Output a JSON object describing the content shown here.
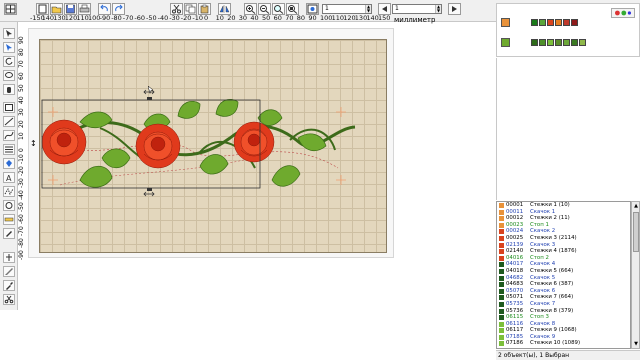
{
  "toolbar": {
    "spin1_value": "1",
    "spin2_value": "1",
    "spin3_value": "1"
  },
  "ruler": {
    "top_ticks": [
      "-150",
      "140",
      "130",
      "120",
      "110",
      "100",
      "-90",
      "-80",
      "-70",
      "-60",
      "-50",
      "-40",
      "-30",
      "-20",
      "-10",
      "0",
      "10",
      "20",
      "30",
      "40",
      "50",
      "60",
      "70",
      "80",
      "90",
      "100",
      "110",
      "120",
      "130",
      "140",
      "150"
    ],
    "left_ticks": [
      "90",
      "80",
      "70",
      "60",
      "50",
      "40",
      "30",
      "20",
      "10",
      "0",
      "-10",
      "-20",
      "-30",
      "-40",
      "-50",
      "-60",
      "-70",
      "-80",
      "-90"
    ],
    "unit_label": "миллиметр"
  },
  "threads": {
    "colors_row1": [
      "#1a7a1a",
      "#5aa53a",
      "#d9431e",
      "#e67e22",
      "#c0392b",
      "#8e1a1a"
    ],
    "colors_row2": [
      "#2e6b1a",
      "#4e8f2a",
      "#7bbf3a",
      "#5a8d2a",
      "#6da83a",
      "#3b7a22",
      "#8fb84a"
    ]
  },
  "stitch_list": [
    {
      "code": "00001",
      "label": "Стежки 1 (10)",
      "type": "stitch",
      "color": "#e8923a"
    },
    {
      "code": "00011",
      "label": "Скачок 1",
      "type": "jump",
      "color": "#e8923a"
    },
    {
      "code": "00012",
      "label": "Стежки 2 (11)",
      "type": "stitch",
      "color": "#e8923a"
    },
    {
      "code": "00023",
      "label": "Стоп 1",
      "type": "stop",
      "color": "#e8923a"
    },
    {
      "code": "00024",
      "label": "Скачок 2",
      "type": "jump",
      "color": "#d9431e"
    },
    {
      "code": "00025",
      "label": "Стежки 3 (2114)",
      "type": "stitch",
      "color": "#d9431e"
    },
    {
      "code": "02139",
      "label": "Скачок 3",
      "type": "jump",
      "color": "#d9431e"
    },
    {
      "code": "02140",
      "label": "Стежки 4 (1876)",
      "type": "stitch",
      "color": "#d9431e"
    },
    {
      "code": "04016",
      "label": "Стоп 2",
      "type": "stop",
      "color": "#d9431e"
    },
    {
      "code": "04017",
      "label": "Скачок 4",
      "type": "jump",
      "color": "#1e5a1e"
    },
    {
      "code": "04018",
      "label": "Стежки 5 (664)",
      "type": "stitch",
      "color": "#1e5a1e"
    },
    {
      "code": "04682",
      "label": "Скачок 5",
      "type": "jump",
      "color": "#1e5a1e"
    },
    {
      "code": "04683",
      "label": "Стежки 6 (387)",
      "type": "stitch",
      "color": "#1e5a1e"
    },
    {
      "code": "05070",
      "label": "Скачок 6",
      "type": "jump",
      "color": "#1e5a1e"
    },
    {
      "code": "05071",
      "label": "Стежки 7 (664)",
      "type": "stitch",
      "color": "#1e5a1e"
    },
    {
      "code": "05735",
      "label": "Скачок 7",
      "type": "jump",
      "color": "#1e5a1e"
    },
    {
      "code": "05736",
      "label": "Стежки 8 (379)",
      "type": "stitch",
      "color": "#1e5a1e"
    },
    {
      "code": "06115",
      "label": "Стоп 3",
      "type": "stop",
      "color": "#1e5a1e"
    },
    {
      "code": "06116",
      "label": "Скачок 8",
      "type": "jump",
      "color": "#7bbf3a"
    },
    {
      "code": "06117",
      "label": "Стежки 9 (1068)",
      "type": "stitch",
      "color": "#7bbf3a"
    },
    {
      "code": "07185",
      "label": "Скачок 9",
      "type": "jump",
      "color": "#7bbf3a"
    },
    {
      "code": "07186",
      "label": "Стежки 10 (1089)",
      "type": "stitch",
      "color": "#7bbf3a"
    }
  ],
  "status": {
    "text": "2 объект(ы), 1 Выбран"
  }
}
